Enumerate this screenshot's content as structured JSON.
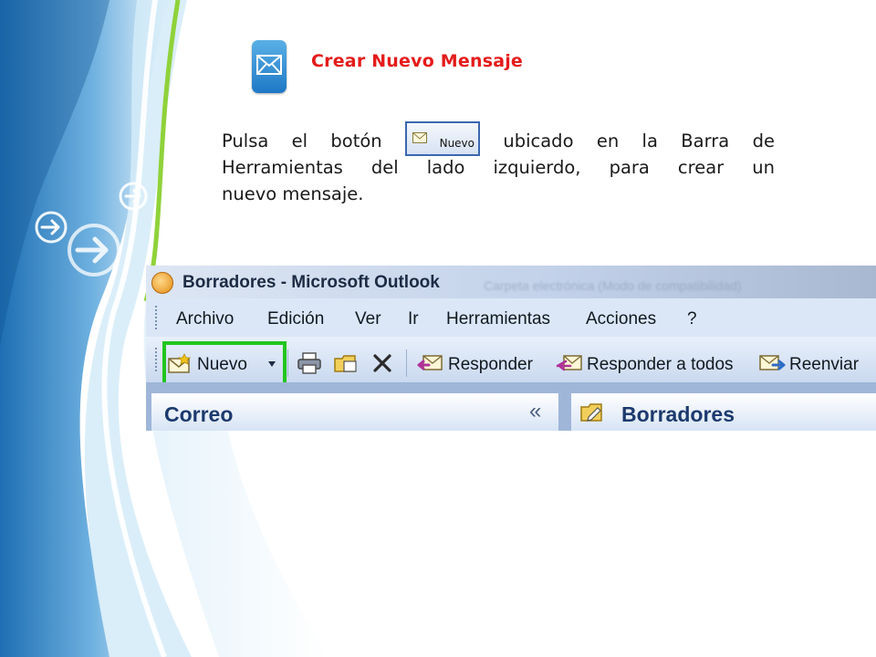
{
  "slide": {
    "title": "Crear Nuevo Mensaje",
    "paragraph": {
      "part1_word1": "Pulsa",
      "part1_word2": "el",
      "part1_word3": "botón",
      "inline_button_label": "Nuevo",
      "part2_word1": "ubicado",
      "part2_word2": "en",
      "part2_word3": "la",
      "part2_word4": "Barra",
      "part2_word5": "de",
      "line2": "Herramientas del lado izquierdo, para crear un",
      "line3": "nuevo mensaje."
    }
  },
  "outlook": {
    "window_title": "Borradores - Microsoft Outlook",
    "blurred_text": "Carpeta electrónica (Modo de compatibilidad)",
    "menu": [
      "Archivo",
      "Edición",
      "Ver",
      "Ir",
      "Herramientas",
      "Acciones",
      "?"
    ],
    "toolbar": {
      "new_label": "Nuevo",
      "reply_label": "Responder",
      "reply_all_label": "Responder a todos",
      "forward_label": "Reenviar"
    },
    "left_pane_title": "Correo",
    "collapse_glyph": "«",
    "right_pane_title": "Borradores"
  },
  "colors": {
    "title_red": "#e51b1b",
    "highlight_green": "#22c51e",
    "outlook_blue": "#1c3a6e"
  },
  "icons": [
    "envelope-icon",
    "nuevo-mail-icon",
    "print-icon",
    "move-folder-icon",
    "delete-icon",
    "reply-icon",
    "reply-all-icon",
    "forward-icon",
    "drafts-folder-icon",
    "outlook-app-icon",
    "arrow-right-icon"
  ]
}
